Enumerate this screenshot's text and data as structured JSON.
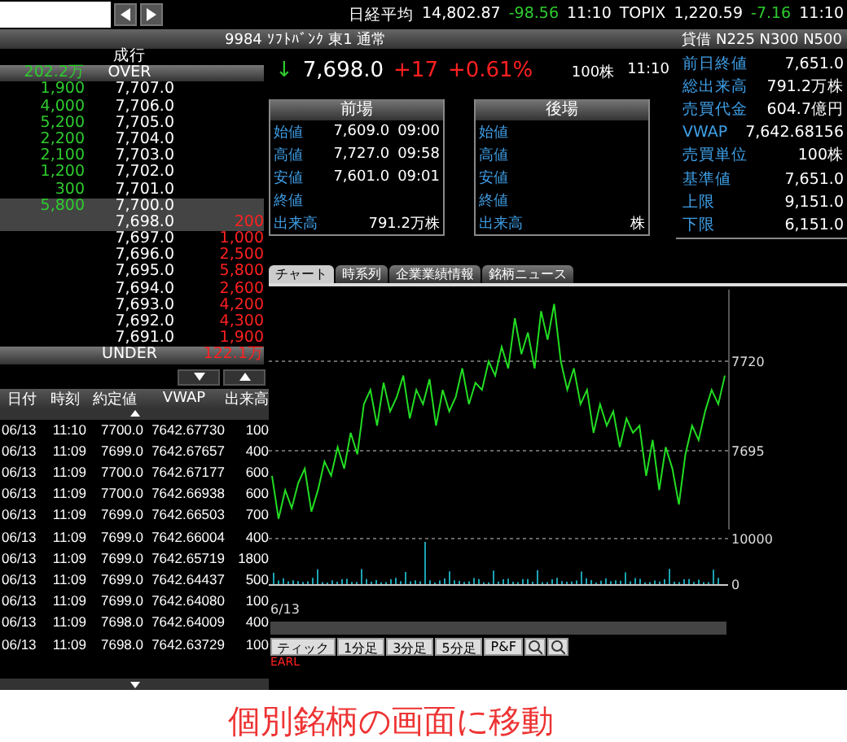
{
  "indices": [
    {
      "name": "日経平均",
      "value": "14,802.87",
      "change": "-98.56",
      "time": "11:10"
    },
    {
      "name": "TOPIX",
      "value": "1,220.59",
      "change": "-7.16",
      "time": "11:10"
    }
  ],
  "stock_header": {
    "title": "9984 ｿﾌﾄﾊﾞﾝｸ 東1 通常",
    "tags": "貸借 N225 N300 N500"
  },
  "order_book": {
    "market_label": "成行",
    "over": {
      "label": "OVER",
      "ask": "202.2万"
    },
    "under": {
      "label": "UNDER",
      "bid": "122.1万"
    },
    "rows": [
      {
        "ask": "1,900",
        "price": "7,707.0",
        "highlighted": false
      },
      {
        "ask": "4,000",
        "price": "7,706.0",
        "highlighted": false
      },
      {
        "ask": "5,200",
        "price": "7,705.0",
        "highlighted": false
      },
      {
        "ask": "2,200",
        "price": "7,704.0",
        "highlighted": false
      },
      {
        "ask": "2,100",
        "price": "7,703.0",
        "highlighted": false
      },
      {
        "ask": "1,200",
        "price": "7,702.0",
        "highlighted": false
      },
      {
        "ask": "300",
        "price": "7,701.0",
        "highlighted": false
      },
      {
        "ask": "5,800",
        "price": "7,700.0",
        "highlighted": true
      },
      {
        "price": "7,698.0",
        "bid": "200",
        "highlighted": true
      },
      {
        "price": "7,697.0",
        "bid": "1,000",
        "highlighted": false
      },
      {
        "price": "7,696.0",
        "bid": "2,500",
        "highlighted": false
      },
      {
        "price": "7,695.0",
        "bid": "5,800",
        "highlighted": false
      },
      {
        "price": "7,694.0",
        "bid": "2,600",
        "highlighted": false
      },
      {
        "price": "7,693.0",
        "bid": "4,200",
        "highlighted": false
      },
      {
        "price": "7,692.0",
        "bid": "4,300",
        "highlighted": false
      },
      {
        "price": "7,691.0",
        "bid": "1,900",
        "highlighted": false
      }
    ]
  },
  "tick_table": {
    "columns": [
      "日付",
      "時刻",
      "約定値",
      "VWAP",
      "出来高"
    ],
    "rows": [
      [
        "06/13",
        "11:10",
        "7700.0",
        "7642.67730",
        "100"
      ],
      [
        "06/13",
        "11:09",
        "7699.0",
        "7642.67657",
        "400"
      ],
      [
        "06/13",
        "11:09",
        "7700.0",
        "7642.67177",
        "600"
      ],
      [
        "06/13",
        "11:09",
        "7700.0",
        "7642.66938",
        "600"
      ],
      [
        "06/13",
        "11:09",
        "7699.0",
        "7642.66503",
        "700"
      ],
      [
        "06/13",
        "11:09",
        "7699.0",
        "7642.66004",
        "400"
      ],
      [
        "06/13",
        "11:09",
        "7699.0",
        "7642.65719",
        "1800"
      ],
      [
        "06/13",
        "11:09",
        "7699.0",
        "7642.64437",
        "500"
      ],
      [
        "06/13",
        "11:09",
        "7699.0",
        "7642.64080",
        "100"
      ],
      [
        "06/13",
        "11:09",
        "7698.0",
        "7642.64009",
        "400"
      ],
      [
        "06/13",
        "11:09",
        "7698.0",
        "7642.63729",
        "100"
      ]
    ]
  },
  "quote": {
    "arrow": "↓",
    "price": "7,698.0",
    "change": "+17",
    "change_pct": "+0.61%",
    "volume": "100株",
    "time": "11:10"
  },
  "sessions": [
    {
      "title": "前場",
      "rows": [
        {
          "label": "始値",
          "value": "7,609.0",
          "time": "09:00"
        },
        {
          "label": "高値",
          "value": "7,727.0",
          "time": "09:58"
        },
        {
          "label": "安値",
          "value": "7,601.0",
          "time": "09:01"
        },
        {
          "label": "終値"
        },
        {
          "label": "出来高",
          "value": "791.2万株"
        }
      ]
    },
    {
      "title": "後場",
      "rows": [
        {
          "label": "始値"
        },
        {
          "label": "高値"
        },
        {
          "label": "安値"
        },
        {
          "label": "終値"
        },
        {
          "label": "出来高",
          "value": "株"
        }
      ]
    }
  ],
  "stats": [
    {
      "label": "前日終値",
      "value": "7,651.0"
    },
    {
      "label": "総出来高",
      "value": "791.2万株"
    },
    {
      "label": "売買代金",
      "value": "604.7億円"
    },
    {
      "label": "VWAP",
      "value": "7,642.68156"
    },
    {
      "label": "売買単位",
      "value": "100株"
    },
    {
      "label": "基準値",
      "value": "7,651.0"
    },
    {
      "label": "上限",
      "value": "9,151.0"
    },
    {
      "label": "下限",
      "value": "6,151.0"
    }
  ],
  "tabs": [
    {
      "label": "チャート",
      "selected": true
    },
    {
      "label": "時系列",
      "selected": false
    },
    {
      "label": "企業業績情報",
      "selected": false
    },
    {
      "label": "銘柄ニュース",
      "selected": false
    }
  ],
  "chart": {
    "chart_data": {
      "type": "line",
      "ylim": [
        7673,
        7740
      ],
      "yticks": [
        7720,
        7695
      ],
      "series": [
        {
          "color": "#22dd22",
          "values": [
            7688,
            7676,
            7684,
            7679,
            7686,
            7690,
            7678,
            7684,
            7692,
            7688,
            7696,
            7690,
            7700,
            7694,
            7708,
            7712,
            7702,
            7714,
            7706,
            7710,
            7716,
            7704,
            7712,
            7708,
            7715,
            7702,
            7712,
            7706,
            7710,
            7718,
            7708,
            7714,
            7712,
            7720,
            7716,
            7724,
            7718,
            7732,
            7722,
            7728,
            7718,
            7734,
            7726,
            7736,
            7720,
            7712,
            7718,
            7708,
            7712,
            7700,
            7708,
            7702,
            7706,
            7696,
            7704,
            7700,
            7702,
            7688,
            7698,
            7684,
            7696,
            7690,
            7680,
            7694,
            7702,
            7698,
            7706,
            7712,
            7708,
            7716
          ]
        }
      ]
    },
    "price_labels": [
      "7720",
      "7695"
    ],
    "volume_labels": [
      "10000",
      "0"
    ],
    "date": "6/13"
  },
  "chart_buttons": [
    "ティック",
    "1分足",
    "3分足",
    "5分足",
    "P&F"
  ],
  "status_text": "EARL",
  "caption": "個別銘柄の画面に移動"
}
